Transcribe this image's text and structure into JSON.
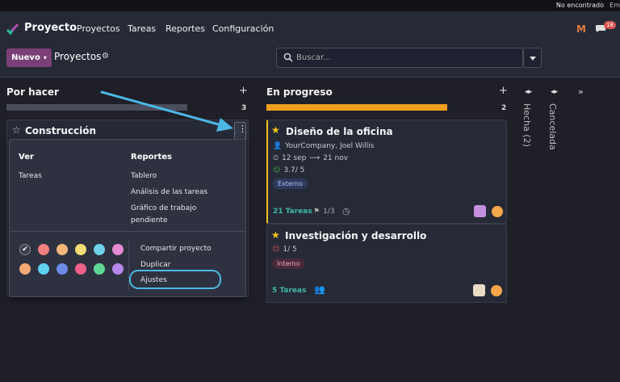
{
  "status_bar": {
    "text": "No encontrado",
    "trailing": "Em"
  },
  "nav": {
    "brand": "Proyecto",
    "menu": [
      {
        "label": "Proyectos"
      },
      {
        "label": "Tareas"
      },
      {
        "label": "Reportes"
      },
      {
        "label": "Configuración"
      }
    ],
    "messages_badge": "18"
  },
  "control": {
    "new_label": "Nuevo",
    "breadcrumb": "Proyectos",
    "search_placeholder": "Buscar..."
  },
  "columns": [
    {
      "title": "Por hacer",
      "count": "3",
      "progress": 1.0,
      "progress_color": "#4a4e5c"
    },
    {
      "title": "En progreso",
      "count": "2",
      "progress": 1.0,
      "progress_color": "#f0a01e"
    }
  ],
  "folded_columns": [
    {
      "title": "Hecha (2)"
    },
    {
      "title": "Cancelada"
    }
  ],
  "todo_card": {
    "title": "Construcción"
  },
  "dropdown": {
    "ver": {
      "heading": "Ver",
      "items": [
        "Tareas"
      ]
    },
    "reportes": {
      "heading": "Reportes",
      "items": [
        "Tablero",
        "Análisis de las tareas",
        "Gráfico de trabajo pendiente"
      ]
    },
    "actions": [
      "Compartir proyecto",
      "Duplicar",
      "Ajustes"
    ],
    "colors": [
      "#ffffff",
      "#f07f7f",
      "#f5b67a",
      "#f5dc74",
      "#6fd2ea",
      "#e58ad5",
      "#f5a974",
      "#5fd0f0",
      "#6e8ae8",
      "#ee5f8a",
      "#5fd896",
      "#b587e8"
    ]
  },
  "cards": [
    {
      "title": "Diseño de la oficina",
      "customer": "YourCompany, Joel Willis",
      "date_start": "12 sep",
      "date_end": "21 nov",
      "rating": "3.7/ 5",
      "tag": "Externo",
      "tasks": "21 Tareas",
      "milestones": "1/3"
    },
    {
      "title": "Investigación y desarrollo",
      "rating": "1/ 5",
      "tag": "Interno",
      "tasks": "5 Tareas"
    }
  ]
}
